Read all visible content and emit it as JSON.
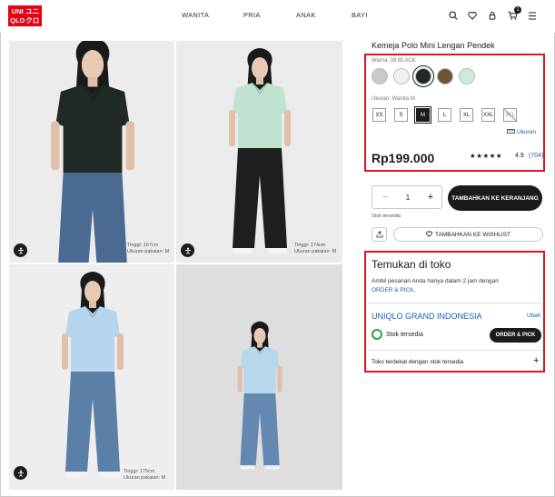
{
  "brand": {
    "logo_text": [
      "UNI",
      "QLO",
      "ユニ",
      "クロ"
    ],
    "accent": "#e60012"
  },
  "nav": {
    "items": [
      "WANITA",
      "PRIA",
      "ANAK",
      "BAYI"
    ]
  },
  "header_icons": [
    "search-icon",
    "heart-icon",
    "user-icon",
    "cart-icon",
    "menu-icon"
  ],
  "cart_count": "1",
  "gallery": {
    "photos": [
      {
        "name": "photo-black-shirt",
        "bg": "#ececec",
        "shirt": "#1f2a24",
        "pants": "#4b6a93",
        "info": [
          "Tinggi: 167cm",
          "Ukuran pakaian: M"
        ]
      },
      {
        "name": "photo-mint-shirt",
        "bg": "#ebebeb",
        "shirt": "#bfe3d0",
        "pants": "#1e1e1e",
        "info": [
          "Tinggi: 174cm",
          "Ukuran pakaian: M"
        ]
      },
      {
        "name": "photo-blue-shirt-front",
        "bg": "#eeeeee",
        "shirt": "#b5d6ee",
        "pants": "#5b7fa6",
        "info": [
          "Tinggi: 175cm",
          "Ukuran pakaian: M"
        ]
      },
      {
        "name": "photo-blue-shirt-back",
        "bg": "#dedede",
        "shirt": "#b8d6ec",
        "pants": "#6488b1",
        "info": []
      }
    ]
  },
  "product": {
    "title": "Kemeja Polo Mini Lengan Pendek",
    "color_label": "Warna: 09 BLACK",
    "swatches": [
      {
        "name": "swatch-gray",
        "color": "#c9c9c9",
        "selected": false
      },
      {
        "name": "swatch-offwhite",
        "color": "#f1f1ef",
        "selected": false
      },
      {
        "name": "swatch-black",
        "color": "#1f2a24",
        "selected": true
      },
      {
        "name": "swatch-brown",
        "color": "#6a5536",
        "selected": false
      },
      {
        "name": "swatch-mint",
        "color": "#cfeadb",
        "selected": false
      }
    ],
    "size_label": "Ukuran: Wanita M",
    "sizes": [
      {
        "label": "XS",
        "state": "available"
      },
      {
        "label": "S",
        "state": "available"
      },
      {
        "label": "M",
        "state": "selected"
      },
      {
        "label": "L",
        "state": "available"
      },
      {
        "label": "XL",
        "state": "available"
      },
      {
        "label": "XXL",
        "state": "available"
      },
      {
        "label": "3XL",
        "state": "unavailable"
      }
    ],
    "size_guide": "Ukuran",
    "price": "Rp199.000",
    "stars": "★★★★★",
    "rating": "4.9",
    "review_count": "(704)",
    "quantity": "1",
    "add_to_cart": "TAMBAHKAN KE KERANJANG",
    "stock_note": "Stok tersedia",
    "wishlist": "TAMBAHKAN KE WISHLIST"
  },
  "store": {
    "title": "Temukan di toko",
    "desc_prefix": "Ambil pesanan Anda hanya dalam 2 jam dengan",
    "desc_link": "ORDER & PICK",
    "desc_suffix": ".",
    "store_name": "UNIQLO GRAND INDONESIA",
    "change": "Ubah",
    "stock_status": "Stok tersedia",
    "order_pick_btn": "ORDER & PICK",
    "nearest": "Toko terdekat dengan stok tersedia"
  }
}
